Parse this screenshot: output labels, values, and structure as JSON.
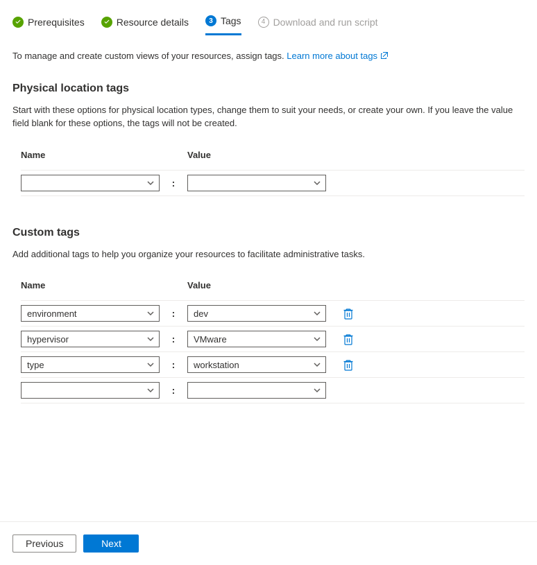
{
  "steps": {
    "prerequisites": "Prerequisites",
    "resource_details": "Resource details",
    "tags": "Tags",
    "download": "Download and run script",
    "current_num": "3",
    "pending_num": "4"
  },
  "intro": {
    "text": "To manage and create custom views of your resources, assign tags. ",
    "link": "Learn more about tags"
  },
  "physical": {
    "heading": "Physical location tags",
    "help": "Start with these options for physical location types, change them to suit your needs, or create your own. If you leave the value field blank for these options, the tags will not be created.",
    "col_name": "Name",
    "col_value": "Value",
    "rows": [
      {
        "name": "",
        "value": ""
      }
    ]
  },
  "custom": {
    "heading": "Custom tags",
    "help": "Add additional tags to help you organize your resources to facilitate administrative tasks.",
    "col_name": "Name",
    "col_value": "Value",
    "rows": [
      {
        "name": "environment",
        "value": "dev",
        "deletable": true
      },
      {
        "name": "hypervisor",
        "value": "VMware",
        "deletable": true
      },
      {
        "name": "type",
        "value": "workstation",
        "deletable": true
      },
      {
        "name": "",
        "value": "",
        "deletable": false
      }
    ]
  },
  "separator": ":",
  "footer": {
    "previous": "Previous",
    "next": "Next"
  }
}
